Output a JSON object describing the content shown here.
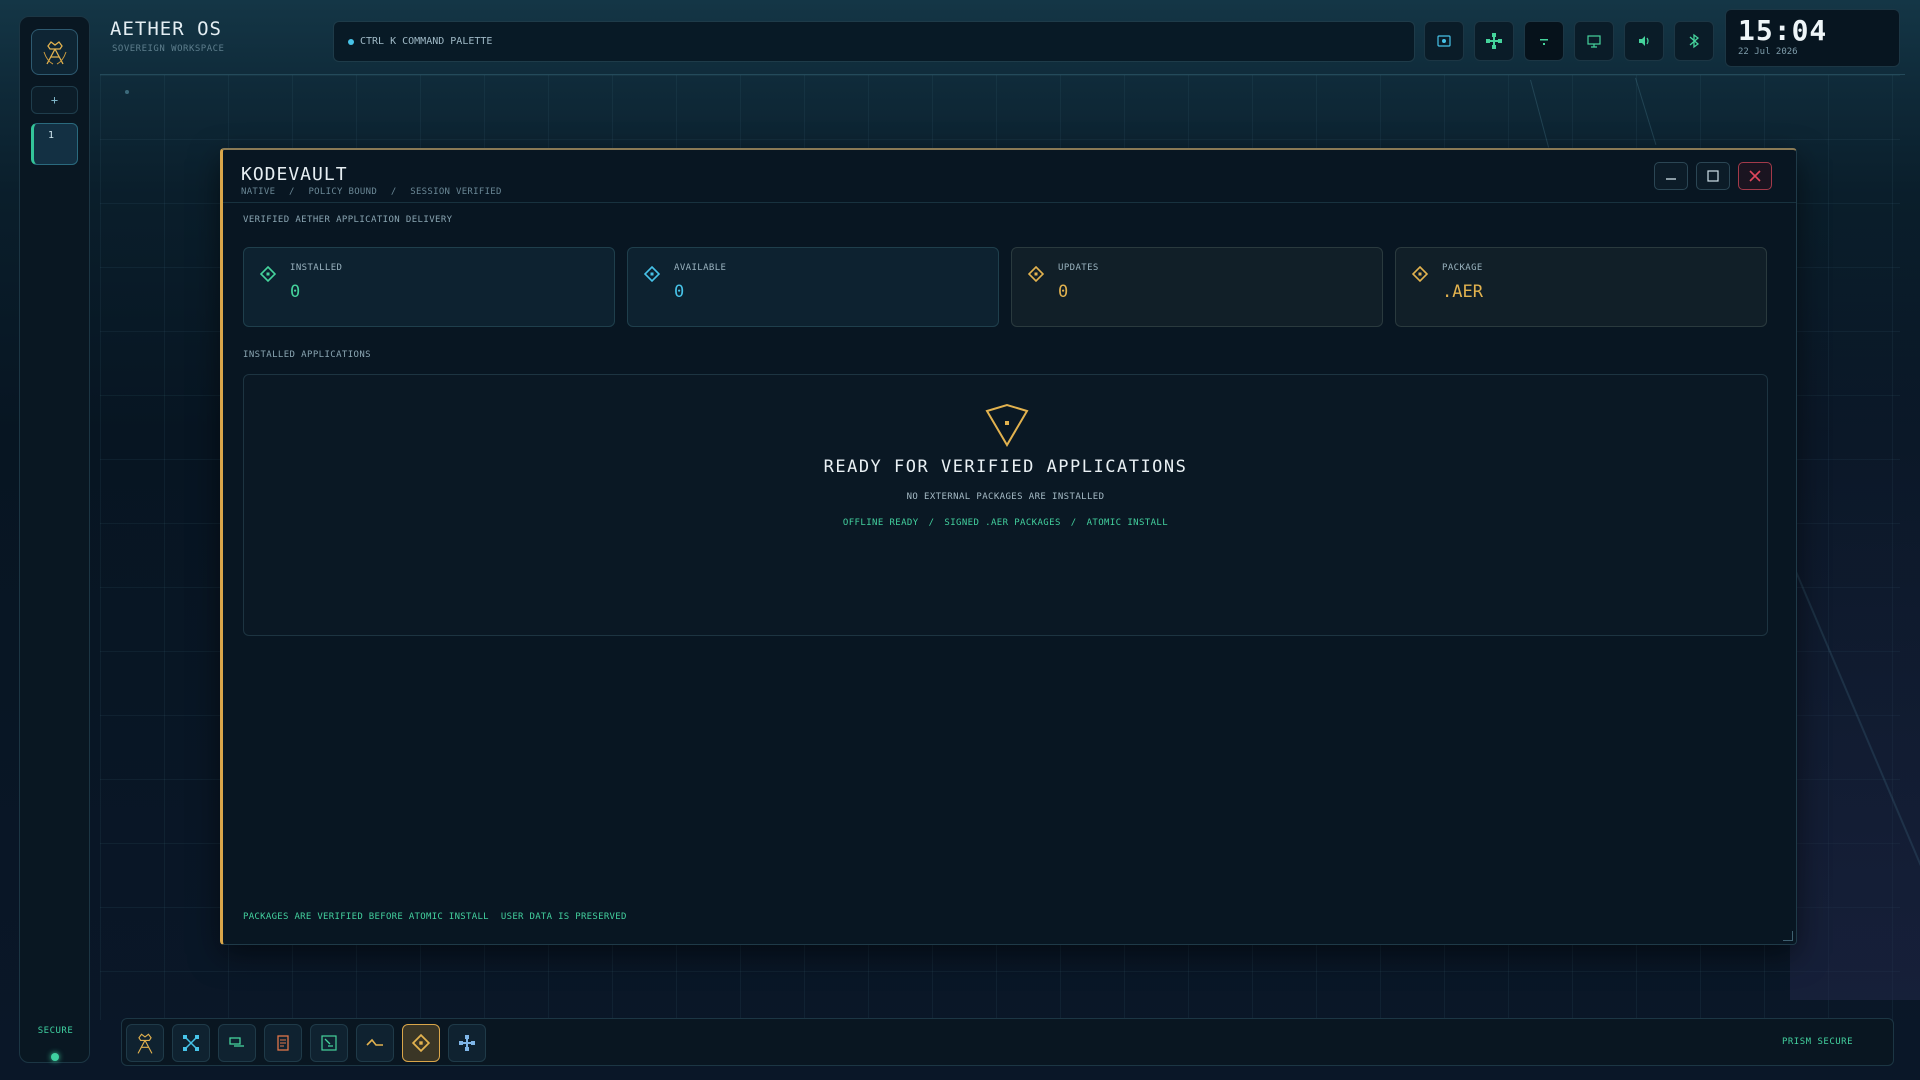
{
  "brand": {
    "title": "AETHER OS",
    "subtitle": "SOVEREIGN WORKSPACE"
  },
  "rail": {
    "add_label": "+",
    "workspace_label": "1",
    "status_label": "SECURE"
  },
  "command_palette": {
    "shortcut": "CTRL K",
    "label": "COMMAND PALETTE"
  },
  "tray_icons": [
    "capture-icon",
    "network-icon",
    "wifi-icon",
    "display-icon",
    "volume-icon",
    "bluetooth-icon"
  ],
  "clock": {
    "time": "15:04",
    "date": "22 Jul 2026"
  },
  "window": {
    "title": "KODEVAULT",
    "breadcrumbs": [
      "NATIVE",
      "/",
      "POLICY BOUND",
      "/",
      "SESSION VERIFIED"
    ],
    "section_label": "VERIFIED AETHER APPLICATION DELIVERY",
    "stats": [
      {
        "label": "INSTALLED",
        "value": "0",
        "color": "#45d39c"
      },
      {
        "label": "AVAILABLE",
        "value": "0",
        "color": "#47c3e8"
      },
      {
        "label": "UPDATES",
        "value": "0",
        "color": "#e2b24f"
      },
      {
        "label": "PACKAGE",
        "value": ".AER",
        "color": "#e2b24f"
      }
    ],
    "apps_label": "INSTALLED APPLICATIONS",
    "empty_state": {
      "title": "READY FOR VERIFIED APPLICATIONS",
      "subtitle": "NO EXTERNAL PACKAGES ARE INSTALLED",
      "tags": [
        "OFFLINE READY",
        "SIGNED .AER PACKAGES",
        "ATOMIC INSTALL"
      ],
      "tag_separator": "/"
    },
    "footer": [
      "PACKAGES ARE VERIFIED BEFORE ATOMIC INSTALL",
      "USER DATA IS PRESERVED"
    ]
  },
  "dock": {
    "items": [
      "aether-crest-icon",
      "expand-icon",
      "terminal-icon",
      "notes-icon",
      "search-icon",
      "activity-icon",
      "kodevault-icon",
      "network-icon"
    ],
    "status": "PRISM SECURE"
  },
  "colors": {
    "accent_gold": "#d9a64a",
    "accent_green": "#43d09e",
    "accent_blue": "#47c3e8",
    "close_red": "#e0475c"
  }
}
